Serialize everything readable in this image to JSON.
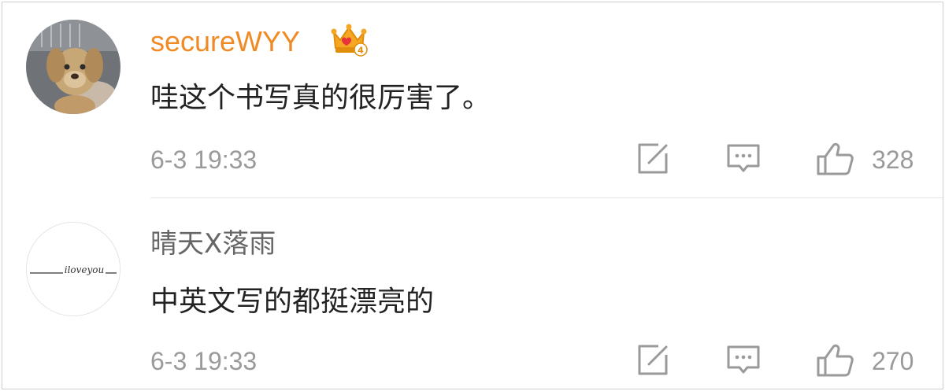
{
  "comments": [
    {
      "username": "secureWYY",
      "username_color": "#f08a24",
      "badge_icon": "crown-icon",
      "badge_number": "4",
      "text": "哇这个书写真的很厉害了。",
      "time": "6-3 19:33",
      "likes": "328",
      "avatar_icon": "plush-dog-avatar"
    },
    {
      "username": "晴天X落雨",
      "username_color": "#666666",
      "text": "中英文写的都挺漂亮的",
      "time": "6-3 19:33",
      "likes": "270",
      "avatar_icon": "iloveyou-script-avatar",
      "avatar_text": "iloveyou"
    }
  ],
  "actions": {
    "repost_icon": "edit-square-icon",
    "reply_icon": "comment-bubble-icon",
    "like_icon": "thumbs-up-icon"
  }
}
